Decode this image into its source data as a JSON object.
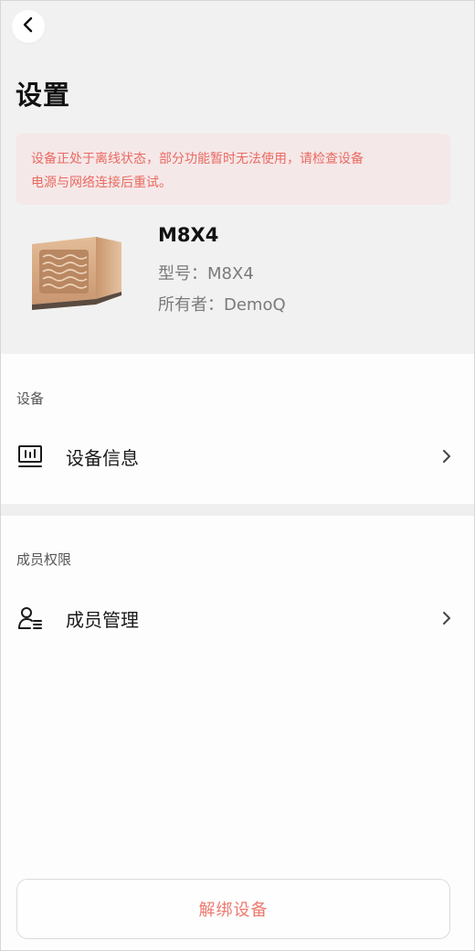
{
  "header": {
    "back_icon": "chevron-left-icon",
    "title": "设置"
  },
  "offline_banner": {
    "line1": "设备正处于离线状态，部分功能暂时无法使用，请检查设备",
    "line2": "电源与网络连接后重试。",
    "color": "#e96a62",
    "background": "#f5e8e8"
  },
  "device": {
    "name": "M8X4",
    "model": "型号：M8X4",
    "owner": "所有者：DemoQ"
  },
  "sections": {
    "device": {
      "label": "设备",
      "item": {
        "label": "设备信息",
        "icon": "device-info-icon"
      }
    },
    "members": {
      "label": "成员权限",
      "item": {
        "label": "成员管理",
        "icon": "member-manage-icon"
      }
    }
  },
  "unbind": {
    "label": "解绑设备",
    "color": "#ec7a6f"
  }
}
